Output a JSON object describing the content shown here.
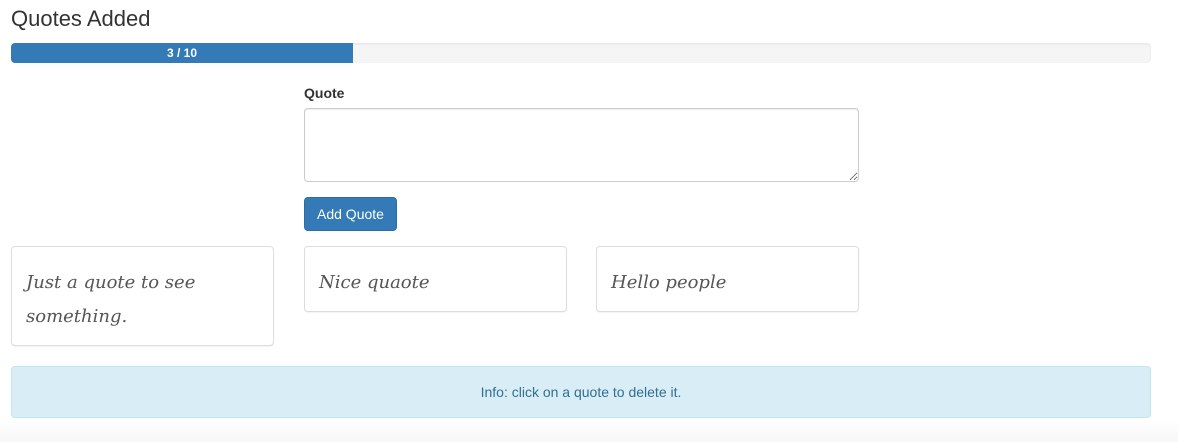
{
  "header": {
    "title": "Quotes Added"
  },
  "progress": {
    "label": "3 / 10",
    "current": 3,
    "max": 10,
    "fraction": 0.3,
    "color": "#337ab7"
  },
  "form": {
    "label": "Quote",
    "textarea_value": "",
    "button_label": "Add Quote"
  },
  "quotes": [
    {
      "text": "Just a quote to see something."
    },
    {
      "text": "Nice quaote"
    },
    {
      "text": "Hello people"
    }
  ],
  "info": {
    "text": "Info: click on a quote to delete it."
  }
}
